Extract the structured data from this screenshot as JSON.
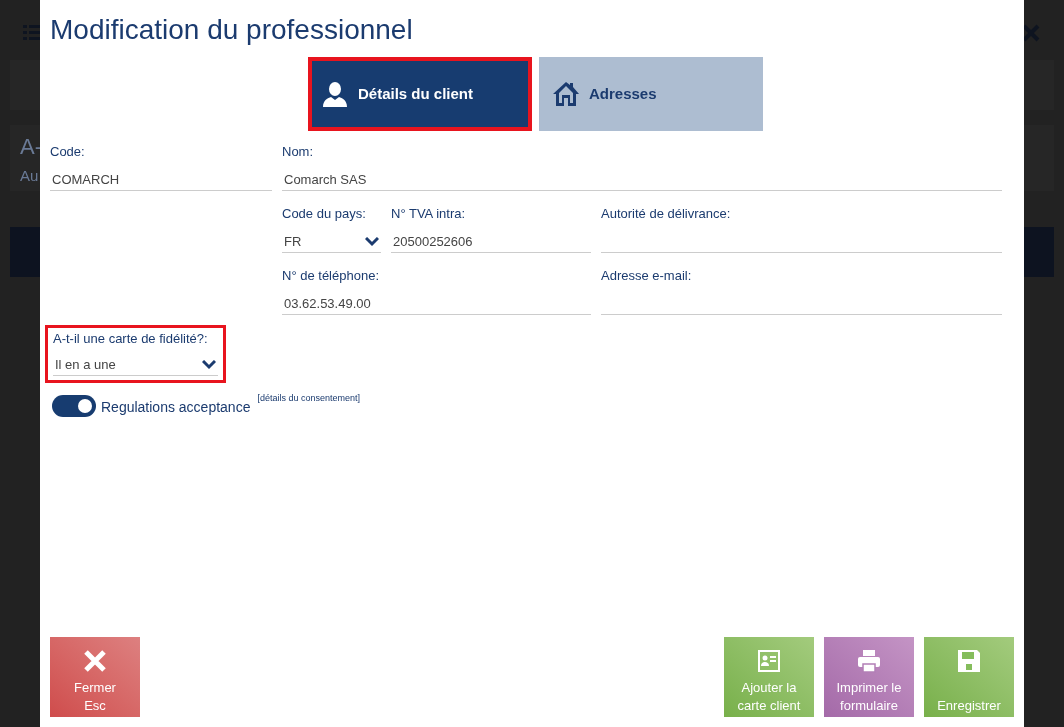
{
  "background": {
    "texts": [
      "A-",
      "Au"
    ]
  },
  "dialog": {
    "title": "Modification du professionnel",
    "tabs": [
      {
        "label": "Détails du client",
        "selected": true,
        "highlighted": true
      },
      {
        "label": "Adresses",
        "selected": false,
        "highlighted": false
      }
    ],
    "fields": [
      {
        "label": "Code:",
        "kind": "text",
        "value": "COMARCH"
      },
      {
        "label": "Nom:",
        "kind": "text",
        "value": "Comarch SAS"
      },
      {
        "label": "Code du pays:",
        "kind": "select",
        "value": "FR"
      },
      {
        "label": "N° TVA intra:",
        "kind": "text",
        "value": "20500252606"
      },
      {
        "label": "Autorité de délivrance:",
        "kind": "text"
      },
      {
        "label": "N° de téléphone:",
        "kind": "text",
        "value": "03.62.53.49.00"
      },
      {
        "label": "Adresse e-mail:",
        "kind": "text"
      }
    ],
    "loyalty": {
      "label": "A-t-il une carte de fidélité?:",
      "kind": "select",
      "value": "Il en a une",
      "highlighted": true
    },
    "consent": {
      "label": "Regulations acceptance",
      "on": true,
      "link": "[détails du consentement]"
    },
    "buttons": [
      {
        "kind": "close",
        "label": "Fermer",
        "shortcut": "Esc"
      },
      {
        "kind": "card",
        "label": "Ajouter la carte client"
      },
      {
        "kind": "print",
        "label": "Imprimer le formulaire"
      },
      {
        "kind": "save",
        "label": "Enregistrer"
      }
    ]
  }
}
